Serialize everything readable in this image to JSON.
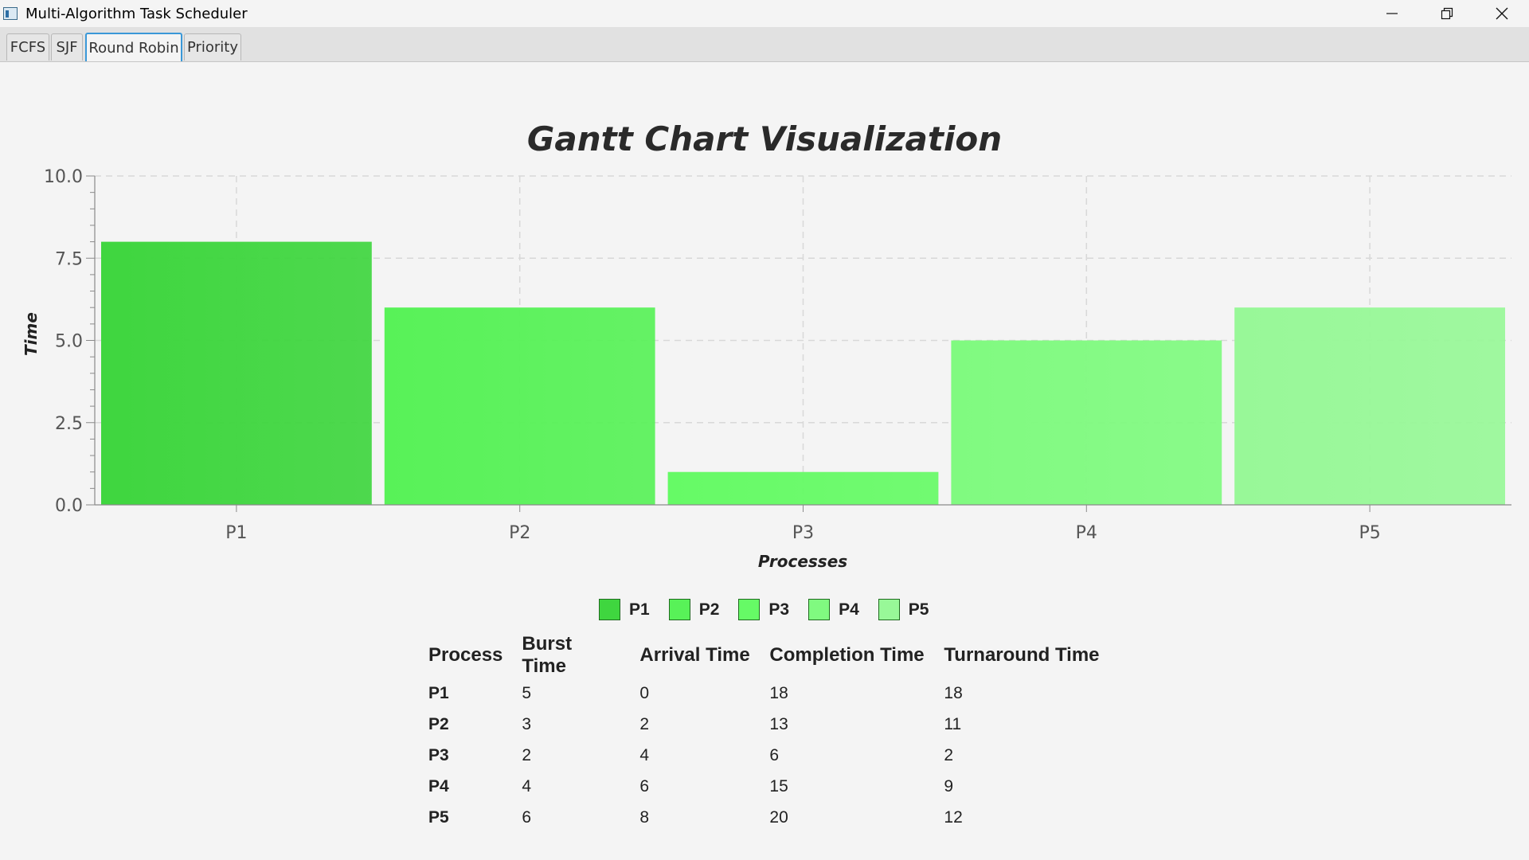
{
  "window": {
    "title": "Multi-Algorithm Task Scheduler",
    "controls": [
      "minimize-icon",
      "restore-icon",
      "close-icon"
    ]
  },
  "tabs": [
    {
      "label": "FCFS",
      "active": false
    },
    {
      "label": "SJF",
      "active": false
    },
    {
      "label": "Round Robin",
      "active": true
    },
    {
      "label": "Priority",
      "active": false
    }
  ],
  "chart_data": {
    "type": "bar",
    "title": "Gantt Chart Visualization",
    "xlabel": "Processes",
    "ylabel": "Time",
    "categories": [
      "P1",
      "P2",
      "P3",
      "P4",
      "P5"
    ],
    "values": [
      8,
      6,
      1,
      5,
      6
    ],
    "ylim": [
      0,
      10
    ],
    "yticks": [
      "0.0",
      "2.5",
      "5.0",
      "7.5",
      "10.0"
    ],
    "grid": true,
    "legend_placement": "bottom",
    "colors": [
      "#3fd63f",
      "#58f258",
      "#66fa66",
      "#80fa80",
      "#98f898"
    ]
  },
  "legend": [
    {
      "label": "P1",
      "color": "#3fd63f"
    },
    {
      "label": "P2",
      "color": "#58f258"
    },
    {
      "label": "P3",
      "color": "#66fa66"
    },
    {
      "label": "P4",
      "color": "#80fa80"
    },
    {
      "label": "P5",
      "color": "#98f898"
    }
  ],
  "table": {
    "headers": [
      "Process",
      "Burst Time",
      "Arrival Time",
      "Completion Time",
      "Turnaround Time"
    ],
    "rows": [
      [
        "P1",
        "5",
        "0",
        "18",
        "18"
      ],
      [
        "P2",
        "3",
        "2",
        "13",
        "11"
      ],
      [
        "P3",
        "2",
        "4",
        "6",
        "2"
      ],
      [
        "P4",
        "4",
        "6",
        "15",
        "9"
      ],
      [
        "P5",
        "6",
        "8",
        "20",
        "12"
      ]
    ]
  }
}
